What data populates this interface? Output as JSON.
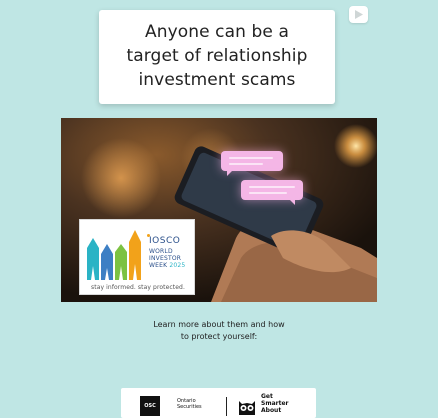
{
  "headline": {
    "lines": [
      "Anyone can be a",
      "target of relationship",
      "investment scams"
    ]
  },
  "badge": {
    "org_name": "IOSCO",
    "week_lines": [
      "WORLD",
      "INVESTOR",
      "WEEK"
    ],
    "year": "2025",
    "tagline": "stay informed. stay protected."
  },
  "cta": {
    "lines": [
      "Learn more about them and how",
      "to protect yourself:"
    ]
  },
  "footer": {
    "osc_mark": "OSC",
    "osc_lines": [
      "Ontario",
      "Securities"
    ],
    "gsa_lines": [
      "Get",
      "Smarter",
      "About"
    ]
  },
  "icons": [
    "play-icon",
    "chat-bubble-icon",
    "iosco-logo-icon",
    "owl-icon"
  ],
  "colors": {
    "background": "#bfe6e4",
    "bubble": "#f4b6e6",
    "iosco_blue": "#2a4f8a",
    "iosco_teal": "#2ab3c5"
  }
}
